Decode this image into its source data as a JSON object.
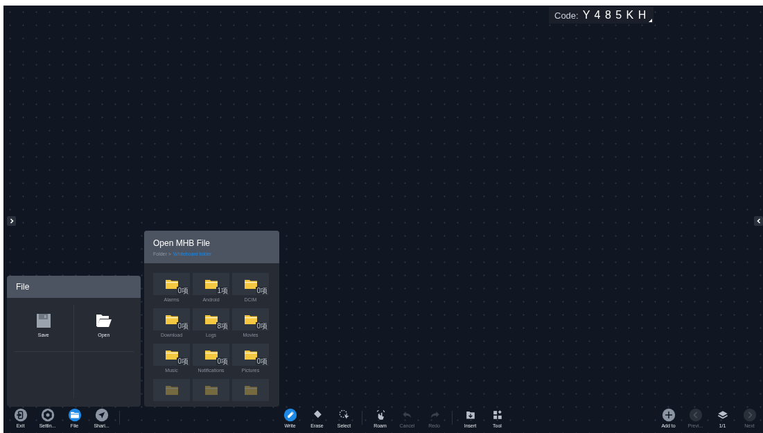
{
  "code_badge": {
    "label": "Code:",
    "value": "Y 4 8 5 K H"
  },
  "file_panel": {
    "title": "File",
    "actions": [
      {
        "kind": "save",
        "label": "Save"
      },
      {
        "kind": "open",
        "label": "Open"
      }
    ]
  },
  "open_panel": {
    "title": "Open MHB File",
    "breadcrumb": {
      "root": "Folder >",
      "current": "Whiteboard folder"
    },
    "folders": [
      {
        "name": "Alarms",
        "count": "0项"
      },
      {
        "name": "Android",
        "count": "1项"
      },
      {
        "name": "DCIM",
        "count": "0项"
      },
      {
        "name": "Download",
        "count": "0项"
      },
      {
        "name": "Logs",
        "count": "8项"
      },
      {
        "name": "Movies",
        "count": "0项"
      },
      {
        "name": "Music",
        "count": "0项"
      },
      {
        "name": "Notifications",
        "count": "0项"
      },
      {
        "name": "Pictures",
        "count": "0项"
      }
    ]
  },
  "toolbar": {
    "left": [
      {
        "kind": "exit",
        "label": "Exit",
        "selected": false,
        "disabled": false
      },
      {
        "kind": "settings",
        "label": "Settin...",
        "selected": false,
        "disabled": false
      },
      {
        "kind": "file",
        "label": "File",
        "selected": true,
        "disabled": false
      },
      {
        "kind": "share",
        "label": "Shari...",
        "selected": false,
        "disabled": false
      }
    ],
    "center": [
      [
        {
          "kind": "write",
          "label": "Write",
          "selected": true,
          "disabled": false
        },
        {
          "kind": "erase",
          "label": "Erase",
          "selected": false,
          "disabled": false
        },
        {
          "kind": "select",
          "label": "Select",
          "selected": false,
          "disabled": false
        }
      ],
      [
        {
          "kind": "roam",
          "label": "Roam",
          "selected": false,
          "disabled": false
        },
        {
          "kind": "undo",
          "label": "Cancel",
          "selected": false,
          "disabled": true
        },
        {
          "kind": "redo",
          "label": "Redo",
          "selected": false,
          "disabled": true
        }
      ],
      [
        {
          "kind": "insert",
          "label": "Insert",
          "selected": false,
          "disabled": false
        },
        {
          "kind": "tool",
          "label": "Tool",
          "selected": false,
          "disabled": false
        }
      ]
    ],
    "right": [
      {
        "kind": "add",
        "label": "Add to",
        "selected": false,
        "disabled": false
      },
      {
        "kind": "prev",
        "label": "Previ...",
        "selected": false,
        "disabled": true
      },
      {
        "kind": "pages",
        "label": "1/1",
        "selected": false,
        "disabled": false
      },
      {
        "kind": "next",
        "label": "Next",
        "selected": false,
        "disabled": true
      }
    ]
  }
}
